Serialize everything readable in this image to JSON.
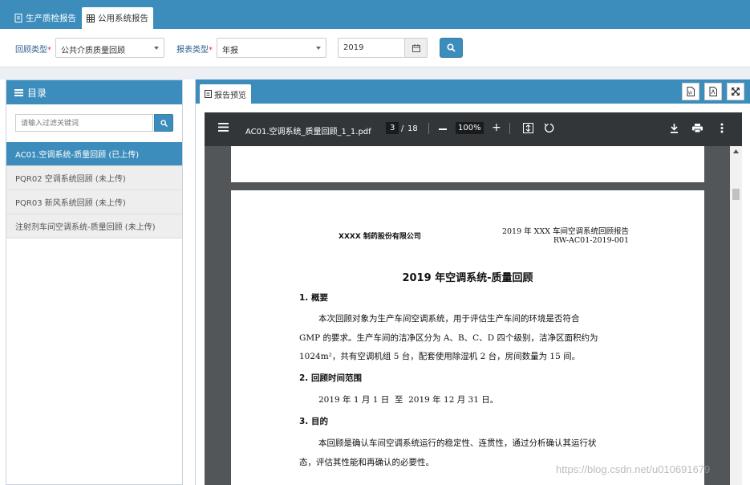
{
  "tabs": [
    {
      "label": "生产质检报告",
      "active": false
    },
    {
      "label": "公用系统报告",
      "active": true
    }
  ],
  "filter": {
    "review_type_label": "回顾类型",
    "review_type_value": "公共介质质量回顾",
    "report_type_label": "报表类型",
    "report_type_value": "年报",
    "required_mark": "*",
    "year_value": "2019"
  },
  "sidebar": {
    "title": "目录",
    "search_placeholder": "请输入过滤关键词",
    "items": [
      {
        "label": "AC01.空调系统-质量回顾 (已上传)",
        "active": true
      },
      {
        "label": "PQR02 空调系统回顾 (未上传)",
        "active": false
      },
      {
        "label": "PQR03 新风系统回顾 (未上传)",
        "active": false
      },
      {
        "label": "注射剂车间空调系统-质量回顾 (未上传)",
        "active": false
      }
    ]
  },
  "preview": {
    "tab_label": "报告预览",
    "buttons": [
      "W",
      "PDF",
      "expand"
    ]
  },
  "pdf": {
    "filename": "AC01.空调系统_质量回顾_1_1.pdf",
    "current_page": "3",
    "page_sep": "/",
    "total_pages": "18",
    "zoom": "100%"
  },
  "doc": {
    "company": "XXXX 制药股份有限公司",
    "header_right_1": "2019 年 XXX 车间空调系统回顾报告",
    "header_right_2": "RW-AC01-2019-001",
    "title": "2019 年空调系统-质量回顾",
    "s1_title": "1. 概要",
    "s1_p1": "本次回顾对象为生产车间空调系统，用于评估生产车间的环境是否符合",
    "s1_p2": "GMP 的要求。生产车间的洁净区分为 A、B、C、D 四个级别，洁净区面积约为",
    "s1_p3": "1024m²，共有空调机组 5 台，配套使用除湿机 2 台，房间数量为 15 间。",
    "s2_title": "2. 回顾时间范围",
    "s2_p1": "2019 年 1 月 1 日  至  2019 年 12 月 31 日。",
    "s3_title": "3. 目的",
    "s3_p1": "本回顾是确认车间空调系统运行的稳定性、连贯性，通过分析确认其运行状",
    "s3_p2": "态，评估其性能和再确认的必要性。"
  },
  "watermark": "https://blog.csdn.net/u010691679"
}
